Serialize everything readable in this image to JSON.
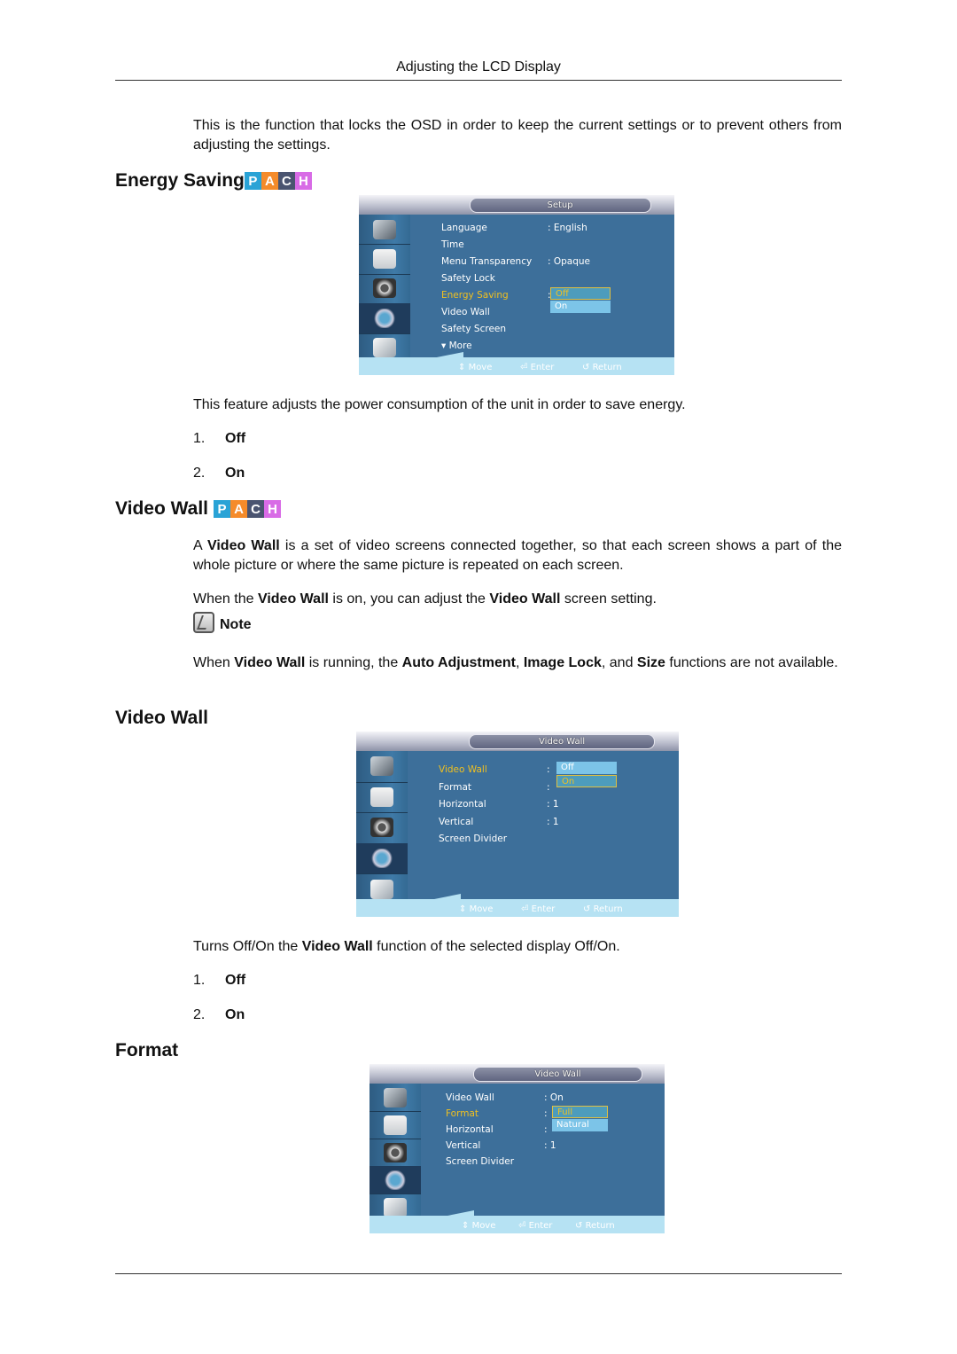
{
  "page": {
    "header": "Adjusting the LCD Display",
    "intro": "This is the function that locks the OSD in order to keep the current settings or to prevent others from adjusting the settings."
  },
  "badge": {
    "letters": [
      "P",
      "A",
      "C",
      "H"
    ],
    "colors": [
      "#2aa3d6",
      "#f58b2a",
      "#4a5470",
      "#d86be6"
    ]
  },
  "energy_saving": {
    "heading": "Energy Saving",
    "osd": {
      "title": "Setup",
      "items": [
        {
          "label": "Language",
          "value": ": English"
        },
        {
          "label": "Time",
          "value": ""
        },
        {
          "label": "Menu Transparency",
          "value": ": Opaque"
        },
        {
          "label": "Safety Lock",
          "value": ""
        },
        {
          "label": "Energy Saving",
          "value": ":"
        },
        {
          "label": "Video Wall",
          "value": ""
        },
        {
          "label": "Safety Screen",
          "value": ""
        },
        {
          "label": "▾ More",
          "value": ""
        }
      ],
      "highlighted": "Energy Saving",
      "options": [
        "Off",
        "On"
      ],
      "selected_option": "Off",
      "hints": [
        "Move",
        "Enter",
        "Return"
      ]
    },
    "description": "This feature adjusts the power consumption of the unit in order to save energy.",
    "list": [
      {
        "num": "1.",
        "val": "Off"
      },
      {
        "num": "2.",
        "val": "On"
      }
    ]
  },
  "video_wall_intro": {
    "heading": "Video Wall",
    "p1_pre": "A ",
    "p1_bold": "Video Wall",
    "p1_post": " is a set of video screens connected together, so that each screen shows a part of the whole picture or where the same picture is repeated on each screen.",
    "p2_a": "When the ",
    "p2_b": "Video Wall",
    "p2_c": " is on, you can adjust the ",
    "p2_d": "Video Wall",
    "p2_e": " screen setting.",
    "note_label": "Note",
    "p3_a": "When ",
    "p3_b": "Video Wall",
    "p3_c": " is running, the ",
    "p3_d": "Auto Adjustment",
    "p3_e": ", ",
    "p3_f": "Image Lock",
    "p3_g": ", and ",
    "p3_h": "Size",
    "p3_i": " functions are not available."
  },
  "video_wall": {
    "heading": "Video Wall",
    "osd": {
      "title": "Video Wall",
      "items": [
        {
          "label": "Video Wall",
          "value": ":"
        },
        {
          "label": "Format",
          "value": ":"
        },
        {
          "label": "Horizontal",
          "value": ":  1"
        },
        {
          "label": "Vertical",
          "value": ":  1"
        },
        {
          "label": "Screen Divider",
          "value": ""
        }
      ],
      "highlighted": "Video Wall",
      "options": [
        "Off",
        "On"
      ],
      "selected_option": "On",
      "hints": [
        "Move",
        "Enter",
        "Return"
      ]
    },
    "desc_a": "Turns Off/On the ",
    "desc_b": "Video Wall",
    "desc_c": " function of the selected display Off/On.",
    "list": [
      {
        "num": "1.",
        "val": "Off"
      },
      {
        "num": "2.",
        "val": "On"
      }
    ]
  },
  "format": {
    "heading": "Format",
    "osd": {
      "title": "Video Wall",
      "items": [
        {
          "label": "Video Wall",
          "value": ":  On"
        },
        {
          "label": "Format",
          "value": ":"
        },
        {
          "label": "Horizontal",
          "value": ":"
        },
        {
          "label": "Vertical",
          "value": ":  1"
        },
        {
          "label": "Screen Divider",
          "value": ""
        }
      ],
      "highlighted": "Format",
      "options": [
        "Full",
        "Natural"
      ],
      "selected_option": "Full",
      "hints": [
        "Move",
        "Enter",
        "Return"
      ]
    }
  }
}
